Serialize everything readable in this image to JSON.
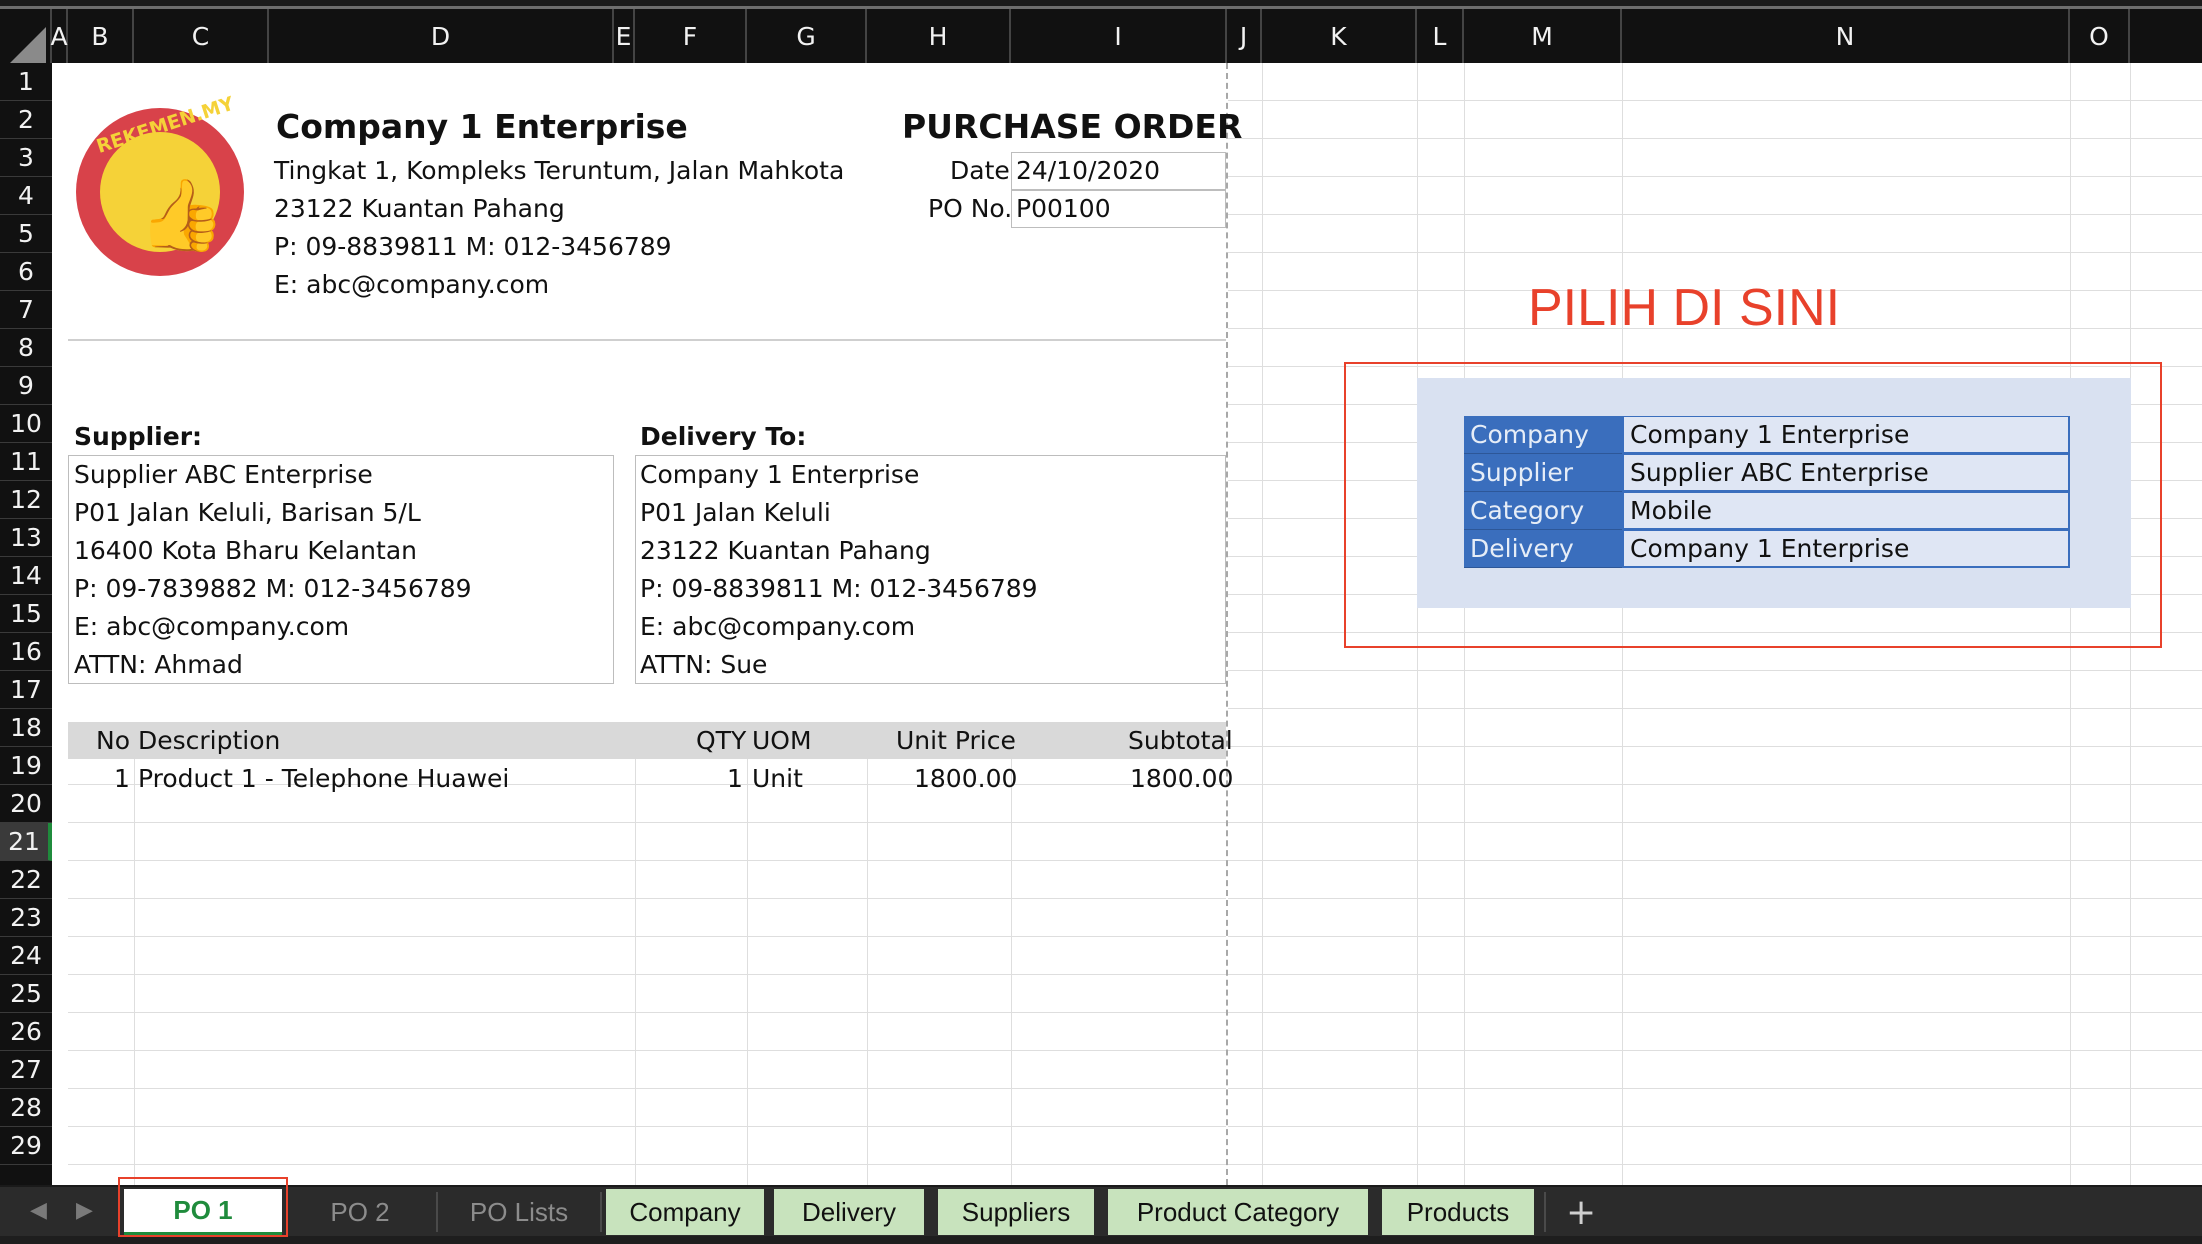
{
  "columns": [
    "A",
    "B",
    "C",
    "D",
    "E",
    "F",
    "G",
    "H",
    "I",
    "J",
    "K",
    "L",
    "M",
    "N",
    "O"
  ],
  "rows": [
    "1",
    "2",
    "3",
    "4",
    "5",
    "6",
    "7",
    "8",
    "9",
    "10",
    "11",
    "12",
    "13",
    "14",
    "15",
    "16",
    "17",
    "18",
    "19",
    "20",
    "21",
    "22",
    "23",
    "24",
    "25",
    "26",
    "27",
    "28",
    "29"
  ],
  "active_row": "21",
  "company": {
    "name": "Company 1 Enterprise",
    "address1": "Tingkat 1, Kompleks Teruntum, Jalan Mahkota",
    "address2": "23122 Kuantan Pahang",
    "phone": "P: 09-8839811  M: 012-3456789",
    "email": "E: abc@company.com",
    "logo_text": "REKEMEN.MY"
  },
  "po": {
    "title": "PURCHASE ORDER",
    "date_label": "Date",
    "date_value": "24/10/2020",
    "no_label": "PO No.",
    "no_value": "P00100"
  },
  "supplier": {
    "heading": "Supplier:",
    "lines": [
      "Supplier ABC Enterprise",
      "P01 Jalan Keluli, Barisan 5/L",
      "16400 Kota Bharu Kelantan",
      "P: 09-7839882  M: 012-3456789",
      "E: abc@company.com",
      "ATTN: Ahmad"
    ]
  },
  "delivery": {
    "heading": "Delivery To:",
    "lines": [
      "Company 1 Enterprise",
      "P01 Jalan Keluli",
      "23122 Kuantan Pahang",
      "P: 09-8839811  M: 012-3456789",
      "E: abc@company.com",
      "ATTN: Sue"
    ]
  },
  "items_table": {
    "headers": {
      "no": "No",
      "description": "Description",
      "qty": "QTY",
      "uom": "UOM",
      "unit_price": "Unit Price",
      "subtotal": "Subtotal"
    },
    "rows": [
      {
        "no": "1",
        "description": "Product 1 - Telephone Huawei",
        "qty": "1",
        "uom": "Unit",
        "unit_price": "1800.00",
        "subtotal": "1800.00"
      }
    ]
  },
  "selector": {
    "title": "PILIH DI SINI",
    "rows": [
      {
        "label": "Company",
        "value": "Company 1 Enterprise"
      },
      {
        "label": "Supplier",
        "value": "Supplier ABC Enterprise"
      },
      {
        "label": "Category",
        "value": "Mobile"
      },
      {
        "label": "Delivery",
        "value": "Company 1 Enterprise"
      }
    ]
  },
  "tabs": {
    "po1": "PO 1",
    "po2": "PO 2",
    "polists": "PO Lists",
    "company": "Company",
    "delivery": "Delivery",
    "suppliers": "Suppliers",
    "product_category": "Product Category",
    "products": "Products",
    "add": "+"
  },
  "colors": {
    "accent_red": "#e8412b",
    "tab_green": "#c8e3bd",
    "selector_blue": "#3a6ebd"
  }
}
